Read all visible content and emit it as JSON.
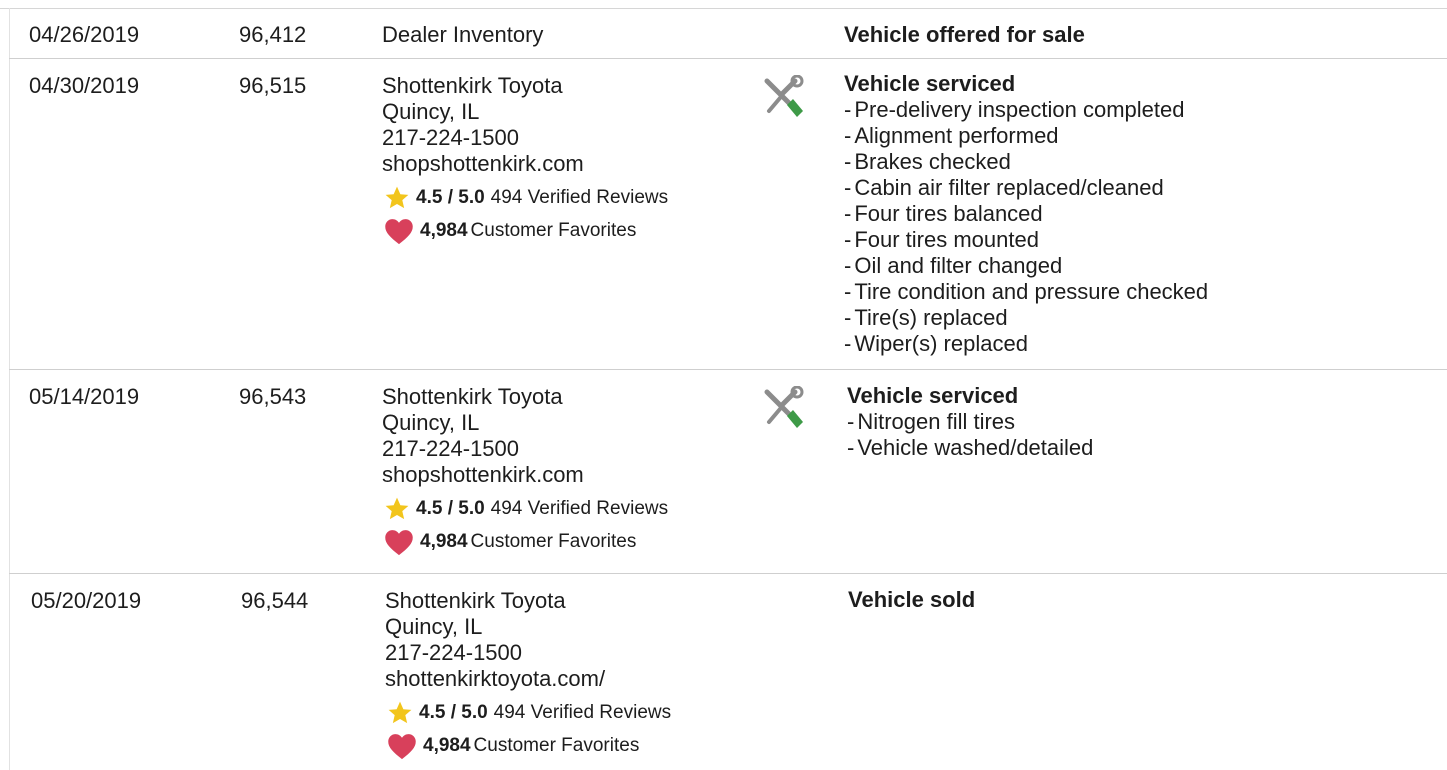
{
  "history": [
    {
      "date": "04/26/2019",
      "odometer": "96,412",
      "source": {
        "lines": [
          "Dealer Inventory"
        ],
        "has_ratings": false
      },
      "icon": "",
      "headline": "Vehicle offered for sale",
      "bullets": []
    },
    {
      "date": "04/30/2019",
      "odometer": "96,515",
      "source": {
        "lines": [
          "Shottenkirk Toyota",
          "Quincy, IL",
          "217-224-1500",
          "shopshottenkirk.com"
        ],
        "has_ratings": true,
        "rating": "4.5 / 5.0",
        "reviews": "494 Verified Reviews",
        "favorites_count": "4,984",
        "favorites_label": "Customer Favorites"
      },
      "icon": "service-tools-icon",
      "headline": "Vehicle serviced",
      "bullets": [
        "Pre-delivery inspection completed",
        "Alignment performed",
        "Brakes checked",
        "Cabin air filter replaced/cleaned",
        "Four tires balanced",
        "Four tires mounted",
        "Oil and filter changed",
        "Tire condition and pressure checked",
        "Tire(s) replaced",
        "Wiper(s) replaced"
      ]
    },
    {
      "date": "05/14/2019",
      "odometer": "96,543",
      "source": {
        "lines": [
          "Shottenkirk Toyota",
          "Quincy, IL",
          "217-224-1500",
          "shopshottenkirk.com"
        ],
        "has_ratings": true,
        "rating": "4.5 / 5.0",
        "reviews": "494 Verified Reviews",
        "favorites_count": "4,984",
        "favorites_label": "Customer Favorites"
      },
      "icon": "service-tools-icon",
      "headline": "Vehicle serviced",
      "bullets": [
        "Nitrogen fill tires",
        "Vehicle washed/detailed"
      ]
    },
    {
      "date": "05/20/2019",
      "odometer": "96,544",
      "source": {
        "lines": [
          "Shottenkirk Toyota",
          "Quincy, IL",
          "217-224-1500",
          "shottenkirktoyota.com/"
        ],
        "has_ratings": true,
        "rating": "4.5 / 5.0",
        "reviews": "494 Verified Reviews",
        "favorites_count": "4,984",
        "favorites_label": "Customer Favorites"
      },
      "icon": "",
      "headline": "Vehicle sold",
      "bullets": []
    }
  ],
  "colors": {
    "star": "#f2c51c",
    "heart": "#d8405b",
    "tool_gray": "#8c8c8c",
    "tool_green": "#3e9a47",
    "rule": "#cfcfcf"
  }
}
